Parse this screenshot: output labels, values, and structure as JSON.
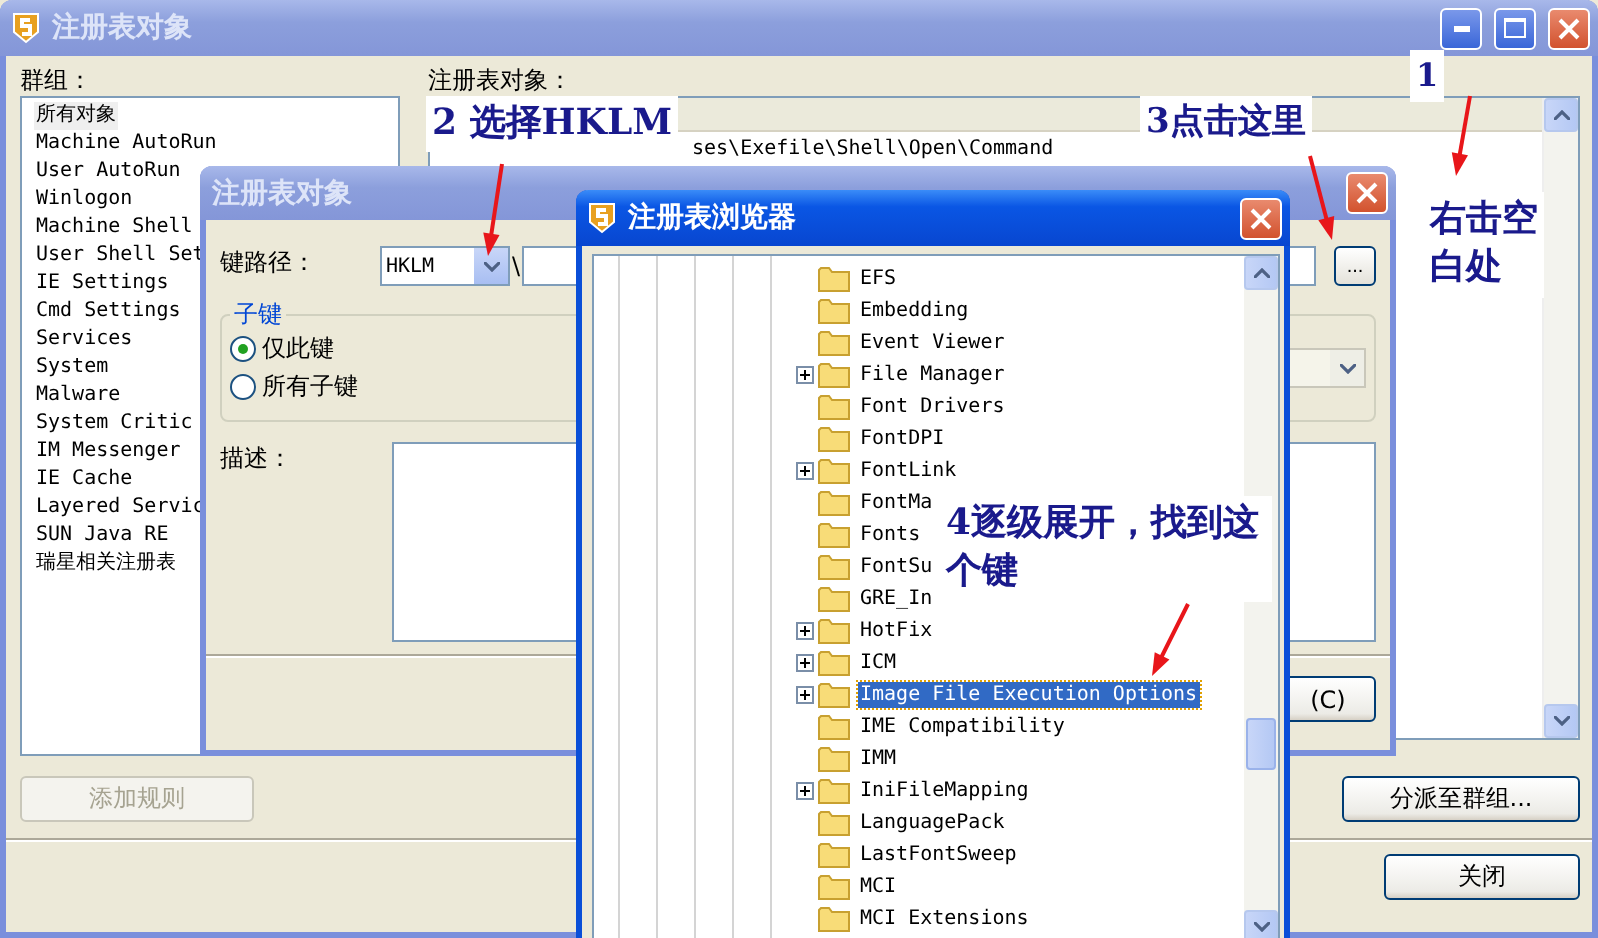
{
  "main_window": {
    "title": "注册表对象",
    "groups_label": "群组：",
    "groups": [
      {
        "label": "所有对象",
        "selected": true
      },
      {
        "label": "Machine AutoRun",
        "selected": false
      },
      {
        "label": "User AutoRun",
        "selected": false
      },
      {
        "label": "Winlogon",
        "selected": false
      },
      {
        "label": "Machine Shell",
        "selected": false
      },
      {
        "label": "User Shell Set",
        "selected": false
      },
      {
        "label": "IE Settings",
        "selected": false
      },
      {
        "label": "Cmd Settings",
        "selected": false
      },
      {
        "label": "Services",
        "selected": false
      },
      {
        "label": "System",
        "selected": false
      },
      {
        "label": "Malware",
        "selected": false
      },
      {
        "label": "System Critic",
        "selected": false
      },
      {
        "label": "IM Messenger",
        "selected": false
      },
      {
        "label": "IE Cache",
        "selected": false
      },
      {
        "label": "Layered Servic",
        "selected": false
      },
      {
        "label": "SUN Java RE",
        "selected": false
      },
      {
        "label": "瑞星相关注册表",
        "selected": false
      }
    ],
    "objects_label": "注册表对象：",
    "object_path": "ses\\Exefile\\Shell\\Open\\Command",
    "buttons": [
      {
        "label": "添加规则",
        "disabled": true
      },
      {
        "label": "分派至群组...",
        "disabled": false
      },
      {
        "label": "关闭",
        "disabled": false
      }
    ]
  },
  "object_dialog": {
    "title": "注册表对象",
    "key_path_label": "键路径：",
    "hive": "HKLM",
    "separator": "\\",
    "browse_button": "...",
    "subkey_group": "子键",
    "subkey_options": [
      {
        "label": "仅此键",
        "selected": true
      },
      {
        "label": "所有子键",
        "selected": false
      }
    ],
    "description_label": "描述：",
    "button": "(C)"
  },
  "registry_browser": {
    "title": "注册表浏览器",
    "tree": [
      {
        "label": "EFS",
        "has_children": false,
        "selected": false
      },
      {
        "label": "Embedding",
        "has_children": false,
        "selected": false
      },
      {
        "label": "Event Viewer",
        "has_children": false,
        "selected": false
      },
      {
        "label": "File Manager",
        "has_children": true,
        "selected": false
      },
      {
        "label": "Font Drivers",
        "has_children": false,
        "selected": false
      },
      {
        "label": "FontDPI",
        "has_children": false,
        "selected": false
      },
      {
        "label": "FontLink",
        "has_children": true,
        "selected": false
      },
      {
        "label": "FontMa",
        "has_children": false,
        "selected": false
      },
      {
        "label": "Fonts",
        "has_children": false,
        "selected": false
      },
      {
        "label": "FontSu",
        "has_children": false,
        "selected": false
      },
      {
        "label": "GRE_In",
        "has_children": false,
        "selected": false
      },
      {
        "label": "HotFix",
        "has_children": true,
        "selected": false
      },
      {
        "label": "ICM",
        "has_children": true,
        "selected": false
      },
      {
        "label": "Image File Execution Options",
        "has_children": true,
        "selected": true
      },
      {
        "label": "IME Compatibility",
        "has_children": false,
        "selected": false
      },
      {
        "label": "IMM",
        "has_children": false,
        "selected": false
      },
      {
        "label": "IniFileMapping",
        "has_children": true,
        "selected": false
      },
      {
        "label": "LanguagePack",
        "has_children": false,
        "selected": false
      },
      {
        "label": "LastFontSweep",
        "has_children": false,
        "selected": false
      },
      {
        "label": "MCI",
        "has_children": false,
        "selected": false
      },
      {
        "label": "MCI Extensions",
        "has_children": false,
        "selected": false
      }
    ]
  },
  "annotations": [
    "1",
    "右击空白处",
    "2 选择HKLM",
    "3点击这里",
    "4逐级展开，找到这个键"
  ]
}
